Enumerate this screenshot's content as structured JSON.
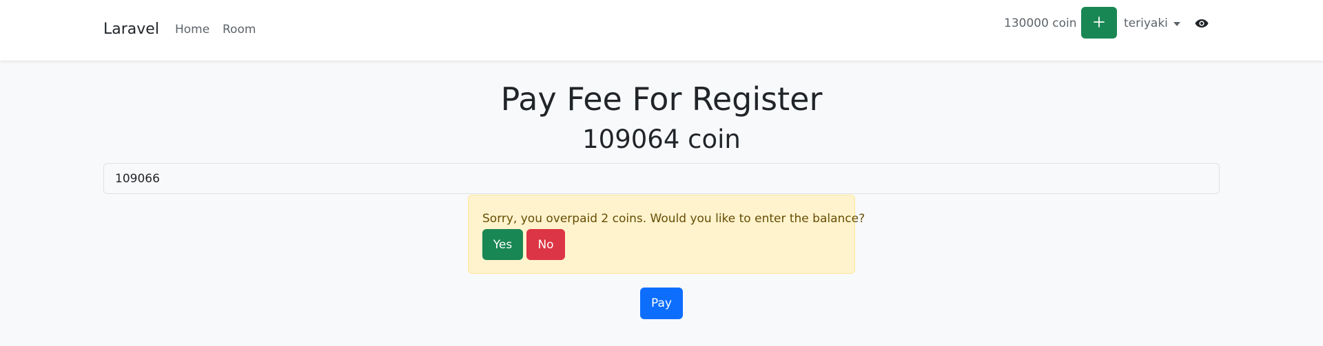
{
  "navbar": {
    "brand": "Laravel",
    "links": [
      {
        "label": "Home"
      },
      {
        "label": "Room"
      }
    ],
    "coin_balance": "130000 coin",
    "add_coin_icon": "plus-icon",
    "username": "teriyaki",
    "visibility_icon": "eye-icon"
  },
  "main": {
    "title": "Pay Fee For Register",
    "fee_amount": "109064 coin",
    "amount_input_value": "109066",
    "alert": {
      "message": "Sorry, you overpaid 2 coins. Would you like to enter the balance?",
      "yes_label": "Yes",
      "no_label": "No"
    },
    "pay_label": "Pay"
  },
  "colors": {
    "success": "#198754",
    "danger": "#dc3545",
    "primary": "#0d6efd",
    "warning_bg": "#fff3cd",
    "warning_text": "#664d03",
    "page_bg": "#f8f9fa"
  }
}
